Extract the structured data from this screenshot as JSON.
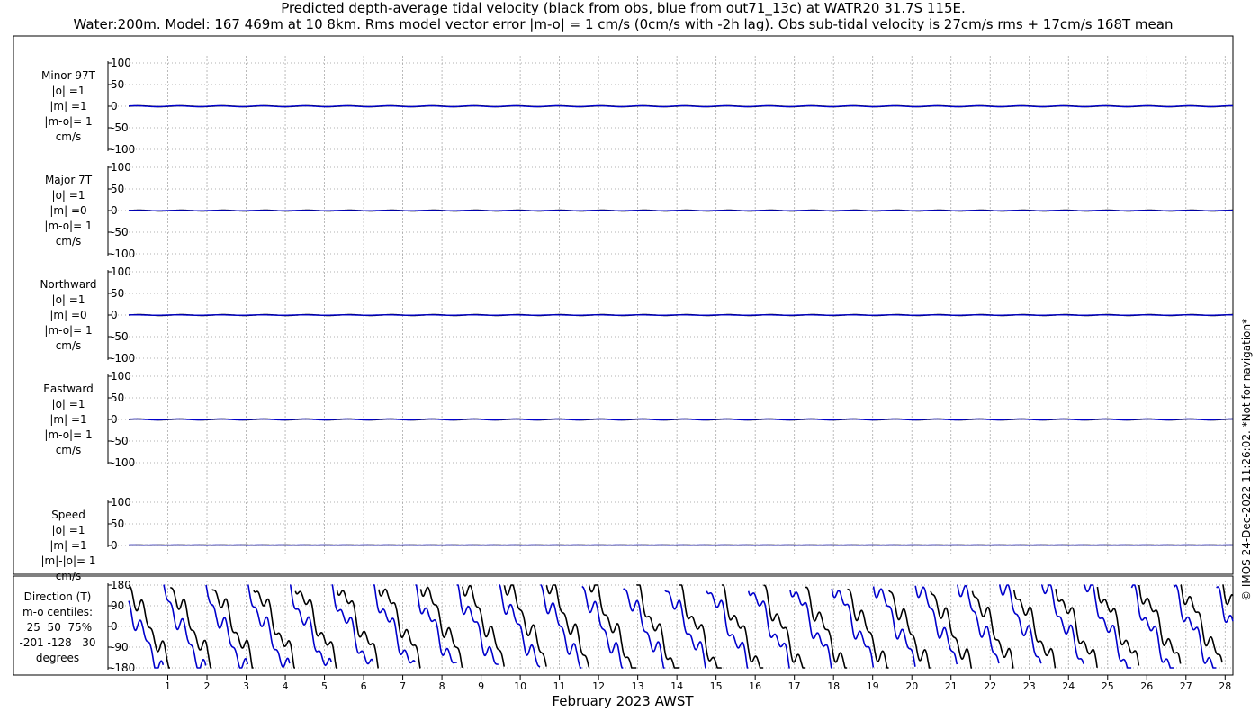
{
  "title": {
    "line1": "Predicted depth-average tidal velocity (black from obs, blue from out71_13c) at WATR20 31.7S 115E.",
    "line2": "Water:200m. Model: 167 469m at 10 8km. Rms model vector error |m-o| = 1 cm/s (0cm/s with -2h lag). Obs sub-tidal velocity is 27cm/s rms + 17cm/s 168T mean"
  },
  "copyright": "© IMOS 24-Dec-2022 11:26:02.  *Not for navigation*",
  "colors": {
    "obs": "#000000",
    "model": "#0000cc",
    "grid": "#aaaaaa"
  },
  "chart_data": [
    {
      "type": "line",
      "panel": "minor",
      "label_lines": [
        "Minor 97T",
        "|o| =1",
        "|m| =1",
        "|m-o|= 1",
        "cm/s"
      ],
      "ylim": [
        -100,
        100
      ],
      "yticks": [
        "100",
        "50",
        "0",
        "-50",
        "-100"
      ],
      "series": [
        {
          "name": "obs",
          "amplitude": 1
        },
        {
          "name": "model",
          "amplitude": 1
        }
      ]
    },
    {
      "type": "line",
      "panel": "major",
      "label_lines": [
        "Major 7T",
        "|o| =1",
        "|m| =0",
        "|m-o|= 1",
        "cm/s"
      ],
      "ylim": [
        -100,
        100
      ],
      "yticks": [
        "100",
        "50",
        "0",
        "-50",
        "-100"
      ],
      "series": [
        {
          "name": "obs",
          "amplitude": 1
        },
        {
          "name": "model",
          "amplitude": 0.5
        }
      ]
    },
    {
      "type": "line",
      "panel": "northward",
      "label_lines": [
        "Northward",
        "|o| =1",
        "|m| =0",
        "|m-o|= 1",
        "cm/s"
      ],
      "ylim": [
        -100,
        100
      ],
      "yticks": [
        "100",
        "50",
        "0",
        "-50",
        "-100"
      ],
      "series": [
        {
          "name": "obs",
          "amplitude": 1
        },
        {
          "name": "model",
          "amplitude": 0.5
        }
      ]
    },
    {
      "type": "line",
      "panel": "eastward",
      "label_lines": [
        "Eastward",
        "|o| =1",
        "|m| =1",
        "|m-o|= 1",
        "cm/s"
      ],
      "ylim": [
        -100,
        100
      ],
      "yticks": [
        "100",
        "50",
        "0",
        "-50",
        "-100"
      ],
      "series": [
        {
          "name": "obs",
          "amplitude": 1
        },
        {
          "name": "model",
          "amplitude": 1
        }
      ]
    },
    {
      "type": "line",
      "panel": "speed",
      "label_lines": [
        "Speed",
        "|o| =1",
        "|m| =1",
        "|m|-|o|= 1",
        "cm/s"
      ],
      "ylim": [
        0,
        100
      ],
      "yticks": [
        "100",
        "50",
        "0"
      ],
      "series": [
        {
          "name": "obs",
          "amplitude": 1
        },
        {
          "name": "model",
          "amplitude": 1
        }
      ]
    },
    {
      "type": "line",
      "panel": "direction",
      "label_lines": [
        "Direction (T)",
        "m-o centiles:",
        " 25  50  75%",
        "-201 -128   30",
        "degrees"
      ],
      "ylim": [
        -180,
        180
      ],
      "yticks": [
        "180",
        "90",
        "0",
        "-90",
        "-180"
      ],
      "series": [
        {
          "name": "obs",
          "cycles_per_day": 0.93,
          "phase": 0.0
        },
        {
          "name": "model",
          "cycles_per_day": 0.93,
          "phase": 0.25
        }
      ]
    }
  ],
  "xaxis": {
    "label": "February 2023 AWST",
    "xlim": [
      0,
      28.2
    ],
    "ticks": [
      "1",
      "2",
      "3",
      "4",
      "5",
      "6",
      "7",
      "8",
      "9",
      "10",
      "11",
      "12",
      "13",
      "14",
      "15",
      "16",
      "17",
      "18",
      "19",
      "20",
      "21",
      "22",
      "23",
      "24",
      "25",
      "26",
      "27",
      "28"
    ]
  }
}
